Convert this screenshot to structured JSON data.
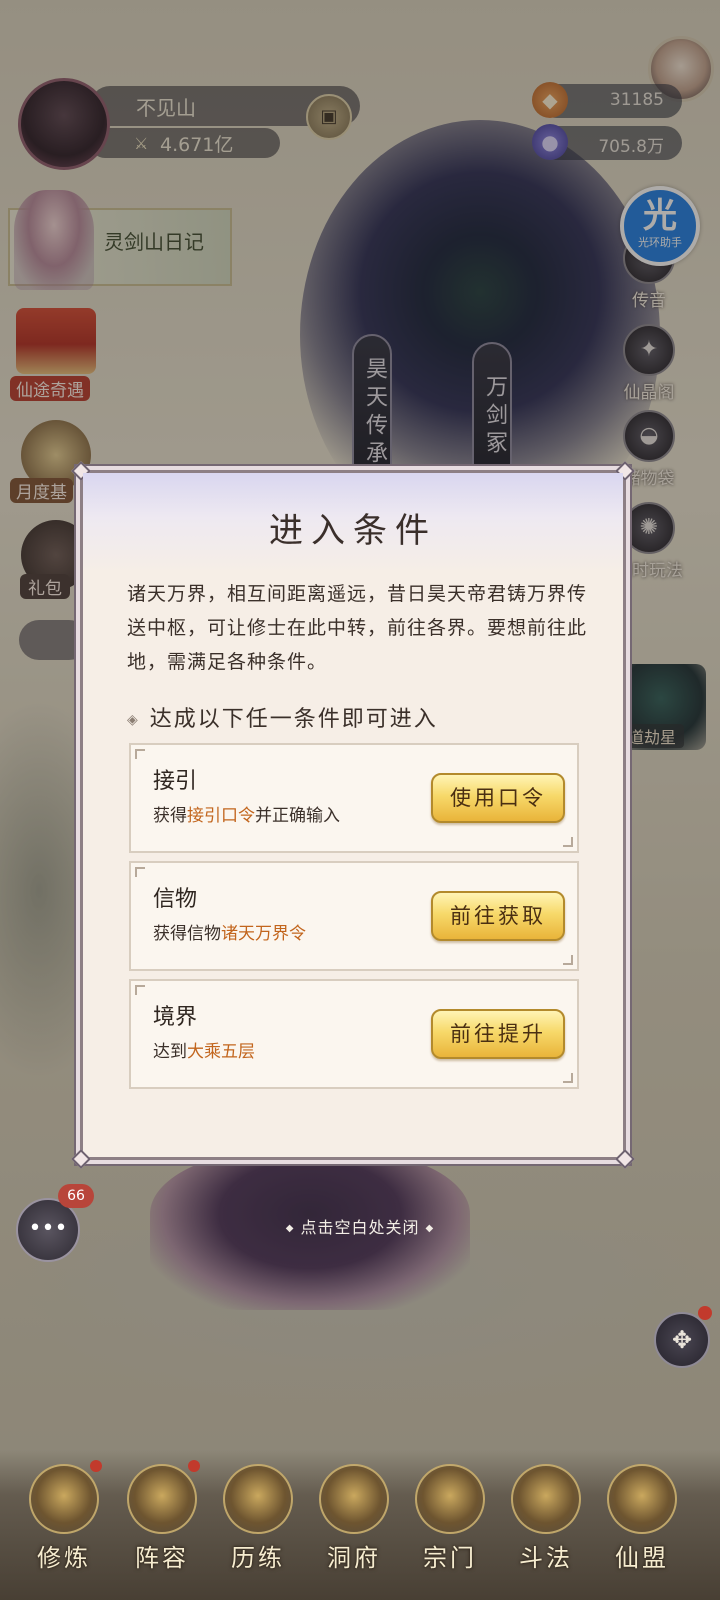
{
  "player": {
    "name": "不见山",
    "power_value": "4.671亿"
  },
  "resources": [
    {
      "icon": "spirit-stone-icon",
      "value": "31185"
    },
    {
      "icon": "immortal-jade-icon",
      "value": "705.8万"
    }
  ],
  "left_features": {
    "diary_label": "灵剑山日记",
    "xiantu_label": "仙途奇遇",
    "yuedu_label": "月度基",
    "libao_label": "礼包"
  },
  "right_features": {
    "chuanyin_label": "传音",
    "xianjing_label": "仙晶阁",
    "zhuwu_label": "储物袋",
    "xianshi_label": "限时玩法",
    "daojie_label": "道劫星"
  },
  "assist_badge": {
    "glyph": "光",
    "text": "光环助手"
  },
  "banners": [
    "昊天传承",
    "万剑冢"
  ],
  "modal": {
    "title": "进入条件",
    "description": "诸天万界，相互间距离遥远，昔日昊天帝君铸万界传送中枢，可让修士在此中转，前往各界。要想前往此地，需满足各种条件。",
    "requirement_heading": "达成以下任一条件即可进入",
    "conditions": [
      {
        "title": "接引",
        "prefix": "获得",
        "highlight": "接引口令",
        "suffix": "并正确输入",
        "button": "使用口令"
      },
      {
        "title": "信物",
        "prefix": "获得信物",
        "highlight": "诸天万界令",
        "suffix": "",
        "button": "前往获取"
      },
      {
        "title": "境界",
        "prefix": "达到",
        "highlight": "大乘五层",
        "suffix": "",
        "button": "前往提升"
      }
    ]
  },
  "close_hint": "点击空白处关闭",
  "chat": {
    "badge": "66"
  },
  "bottom_nav": [
    "修炼",
    "阵容",
    "历练",
    "洞府",
    "宗门",
    "斗法",
    "仙盟"
  ]
}
